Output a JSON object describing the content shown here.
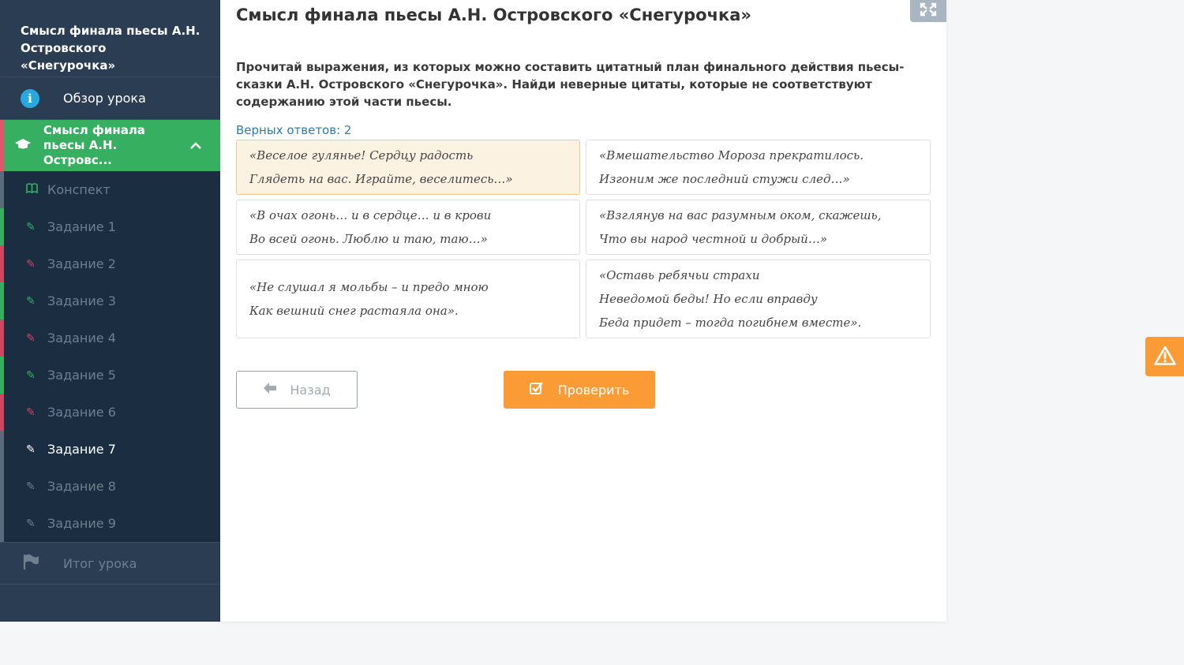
{
  "sidebar": {
    "title": "Смысл финала пьесы А.Н. Островского «Снегурочка»",
    "overview_label": "Обзор урока",
    "current_label": "Смысл финала\nпьесы А.Н. Островс...",
    "items": [
      {
        "label": "Конспект",
        "state": "konspekt"
      },
      {
        "label": "Задание 1",
        "state": "ok"
      },
      {
        "label": "Задание 2",
        "state": "bad"
      },
      {
        "label": "Задание 3",
        "state": "ok"
      },
      {
        "label": "Задание 4",
        "state": "bad"
      },
      {
        "label": "Задание 5",
        "state": "ok"
      },
      {
        "label": "Задание 6",
        "state": "bad"
      },
      {
        "label": "Задание 7",
        "state": "active"
      },
      {
        "label": "Задание 8",
        "state": "todo"
      },
      {
        "label": "Задание 9",
        "state": "todo"
      }
    ],
    "summary_label": "Итог урока"
  },
  "main": {
    "title": "Смысл финала пьесы А.Н. Островского «Снегурочка»",
    "instruction": "Прочитай выражения, из которых можно составить цитатный план финального действия пьесы-сказки А.Н. Островского «Снегурочка». Найди неверные цитаты, которые не соответствуют содержанию этой части пьесы.",
    "correct_count": "Верных ответов: 2",
    "cards": [
      {
        "lines": [
          "«Веселое гулянье! Сердцу радость",
          "Глядеть на вас. Играйте, веселитесь…»"
        ],
        "selected": true
      },
      {
        "lines": [
          "«Вмешательство Мороза прекратилось.",
          "Изгоним же последний стужи след…»"
        ],
        "selected": false
      },
      {
        "lines": [
          "«В очах огонь… и в сердце… и в крови",
          "Во всей огонь. Люблю и таю, таю…»"
        ],
        "selected": false
      },
      {
        "lines": [
          "«Взглянув на вас разумным оком, скажешь,",
          "Что вы народ честной и добрый…»"
        ],
        "selected": false
      },
      {
        "lines": [
          "«Не слушал я мольбы – и предо мною",
          "Как вешний снег растаяла она»."
        ],
        "selected": false
      },
      {
        "lines": [
          "«Оставь ребячьи страхи",
          "Неведомой беды! Но если вправду",
          "Беда придет – тогда погибнем вместе»."
        ],
        "selected": false
      }
    ],
    "back_label": "Назад",
    "check_label": "Проверить"
  },
  "colors": {
    "sidebar_bg": "#1f3247",
    "current_green": "#36b060",
    "error_red": "#d14560",
    "accent_orange": "#fb9b35",
    "link_blue": "#2e7ab0",
    "selected_card_bg": "#fbf2e1"
  },
  "icons": {
    "overview": "info-icon",
    "current": "graduation-cap-icon",
    "konspekt": "book-icon",
    "task": "edit-icon",
    "summary": "flag-icon",
    "expand": "expand-icon",
    "back": "arrow-left-icon",
    "check": "check-square-icon",
    "warning": "warning-icon"
  }
}
